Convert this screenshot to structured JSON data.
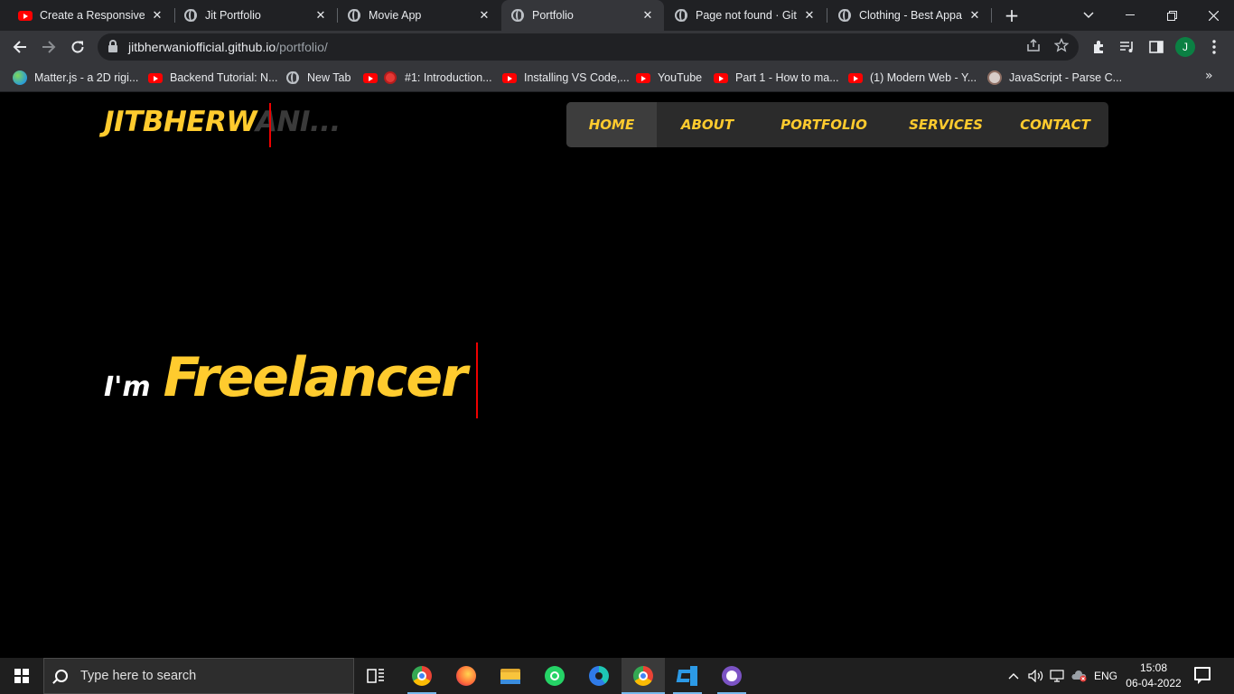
{
  "browser": {
    "tabs": [
      {
        "title": "Create a Responsive P",
        "favicon": "youtube-icon",
        "active": false
      },
      {
        "title": "Jit Portfolio",
        "favicon": "globe-icon",
        "active": false
      },
      {
        "title": "Movie App",
        "favicon": "globe-icon",
        "active": false
      },
      {
        "title": "Portfolio",
        "favicon": "globe-icon",
        "active": true
      },
      {
        "title": "Page not found · GitH",
        "favicon": "globe-icon",
        "active": false
      },
      {
        "title": "Clothing - Best Appar",
        "favicon": "globe-icon",
        "active": false
      }
    ],
    "close_glyph": "✕",
    "new_tab_glyph": "+",
    "address": {
      "host": "jitbherwaniofficial.github.io",
      "path": "/portfolio/"
    },
    "profile_initial": "J",
    "bookmarks": [
      {
        "label": "Matter.js - a 2D rigi...",
        "favicon": "matter-icon"
      },
      {
        "label": "Backend Tutorial: N...",
        "favicon": "youtube-icon"
      },
      {
        "label": "New Tab",
        "favicon": "globe-icon"
      },
      {
        "label": "#1: Introduction...",
        "favicon": "record-icon"
      },
      {
        "label": "Installing VS Code,...",
        "favicon": "youtube-icon"
      },
      {
        "label": "YouTube",
        "favicon": "youtube-icon"
      },
      {
        "label": "Part 1 - How to ma...",
        "favicon": "youtube-icon"
      },
      {
        "label": "(1) Modern Web - Y...",
        "favicon": "youtube-icon"
      },
      {
        "label": "JavaScript - Parse C...",
        "favicon": "avatar-icon"
      }
    ]
  },
  "site": {
    "logo_typed": "JITBHERW",
    "logo_rest": "ANI...",
    "nav": [
      "HOME",
      "ABOUT",
      "PORTFOLIO",
      "SERVICES",
      "CONTACT"
    ],
    "hero_prefix": "I'm",
    "hero_role": "Freelancer",
    "colors": {
      "accent": "#ffcb2e",
      "background": "#000000",
      "cursor": "#ee0000",
      "nav_bg": "#2b2b2b"
    }
  },
  "taskbar": {
    "search_placeholder": "Type here to search",
    "apps": [
      "task-view-icon",
      "chrome-icon",
      "firefox-icon",
      "file-explorer-icon",
      "whatsapp-icon",
      "edge-icon",
      "chrome-icon",
      "vscode-icon",
      "github-desktop-icon"
    ],
    "language": "ENG",
    "time": "15:08",
    "date": "06-04-2022"
  }
}
